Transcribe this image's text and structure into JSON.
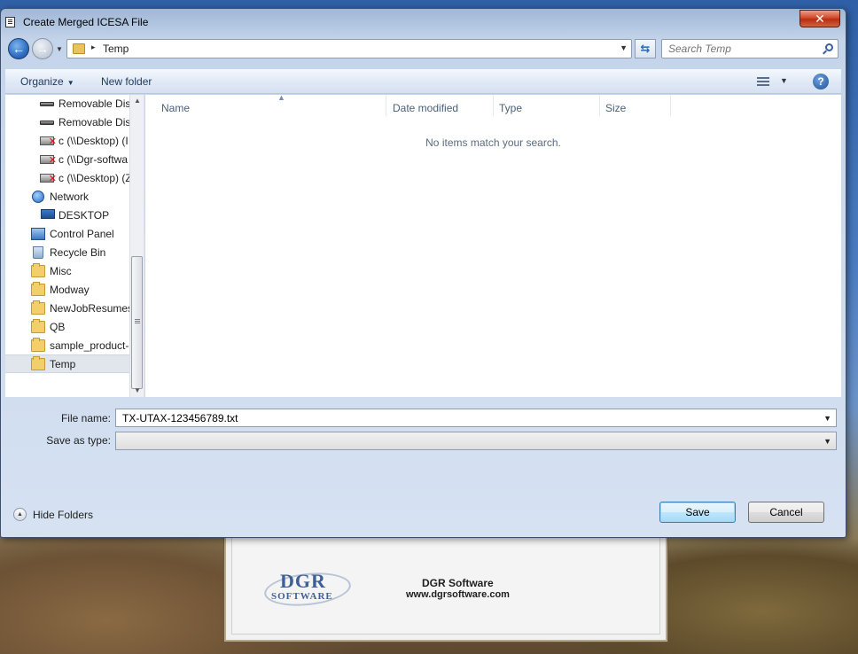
{
  "background_app": {
    "logo_big": "DGR",
    "logo_small": "SOFTWARE",
    "company": "DGR Software",
    "url": "www.dgrsoftware.com"
  },
  "dialog": {
    "title": "Create Merged ICESA File",
    "close_label": "✕",
    "address": {
      "path": "Temp",
      "separator": "▸"
    },
    "search": {
      "placeholder": "Search Temp"
    },
    "toolbar": {
      "organize": "Organize",
      "new_folder": "New folder",
      "help": "?"
    },
    "nav_items": [
      {
        "label": "Removable Dis",
        "icon": "removable-drive-icon"
      },
      {
        "label": "Removable Dis",
        "icon": "removable-drive-icon"
      },
      {
        "label": "c (\\\\Desktop) (I",
        "icon": "network-drive-disconnected-icon"
      },
      {
        "label": "c (\\\\Dgr-softwa",
        "icon": "network-drive-disconnected-icon"
      },
      {
        "label": "c (\\\\Desktop) (Z",
        "icon": "network-drive-disconnected-icon"
      },
      {
        "label": "Network",
        "icon": "network-icon"
      },
      {
        "label": "DESKTOP",
        "icon": "computer-icon"
      },
      {
        "label": "Control Panel",
        "icon": "control-panel-icon"
      },
      {
        "label": "Recycle Bin",
        "icon": "recycle-bin-icon"
      },
      {
        "label": "Misc",
        "icon": "folder-icon"
      },
      {
        "label": "Modway",
        "icon": "folder-icon"
      },
      {
        "label": "NewJobResumes",
        "icon": "folder-icon"
      },
      {
        "label": "QB",
        "icon": "folder-icon"
      },
      {
        "label": "sample_product-",
        "icon": "folder-icon"
      },
      {
        "label": "Temp",
        "icon": "folder-icon",
        "selected": true
      }
    ],
    "columns": [
      "Name",
      "Date modified",
      "Type",
      "Size"
    ],
    "empty_message": "No items match your search.",
    "file_name_label": "File name:",
    "file_name_value": "TX-UTAX-123456789.txt",
    "save_as_type_label": "Save as type:",
    "save_as_type_value": "",
    "hide_folders": "Hide Folders",
    "save_button": "Save",
    "cancel_button": "Cancel"
  }
}
